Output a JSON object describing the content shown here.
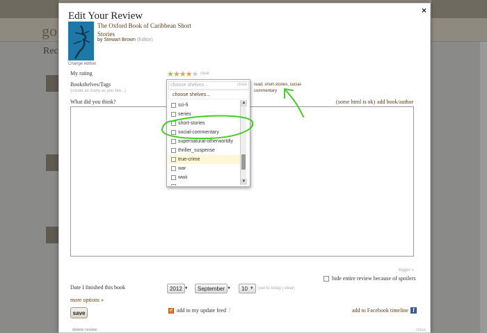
{
  "background": {
    "logo": "go",
    "heading": "Rece"
  },
  "modal": {
    "title": "Edit Your Review",
    "close_symbol": "×",
    "book": {
      "title": "The Oxford Book of Caribbean Short Stories",
      "by": "by",
      "author": "Stewart Brown",
      "role": "(Editor)",
      "change_edition": "Change edition"
    },
    "rating": {
      "label": "My rating",
      "stars_filled": 4,
      "stars_total": 5,
      "clear": "clear"
    },
    "shelves": {
      "label": "Bookshelves/Tags",
      "hint": "(create as many as you like...)",
      "current": "read, short-stories, social-commentary"
    },
    "review": {
      "label": "What did you think?",
      "html_ok": "(some html is ok)",
      "add_link": "add book/author",
      "text": ""
    },
    "bigger": "bigger »",
    "spoiler": {
      "label": "hide entire review because of spoilers",
      "checked": false
    },
    "date": {
      "label": "Date I finished this book",
      "year": "2012",
      "month": "September",
      "day": "10",
      "set_today": "(set to today | clear)"
    },
    "more_options": "more options »",
    "save": "save",
    "update_feed": {
      "label": "add to my update feed",
      "help": "?",
      "checked": true
    },
    "facebook": {
      "label": "add to Facebook timeline",
      "icon": "facebook-icon",
      "icon_glyph": "f"
    },
    "delete_review": "delete review",
    "close_bottom": "close"
  },
  "shelves_dropdown": {
    "placeholder": "choose shelves...",
    "close": "close",
    "choose_label": "choose shelves...",
    "items": [
      {
        "label": "sci-fi",
        "checked": false
      },
      {
        "label": "series",
        "checked": false
      },
      {
        "label": "short-stories",
        "checked": false
      },
      {
        "label": "social-commentary",
        "checked": false
      },
      {
        "label": "supernatural-otherworldly",
        "checked": false
      },
      {
        "label": "thriller_suspense",
        "checked": false
      },
      {
        "label": "true-crime",
        "checked": false,
        "highlighted": true
      },
      {
        "label": "war",
        "checked": false
      },
      {
        "label": "wwii",
        "checked": false
      },
      {
        "label": "",
        "checked": false
      }
    ]
  },
  "colors": {
    "link_brown": "#5b3a1a",
    "star_on": "#e8a23b",
    "annotation_green": "#44cc22",
    "highlight": "#fdf7d6"
  }
}
